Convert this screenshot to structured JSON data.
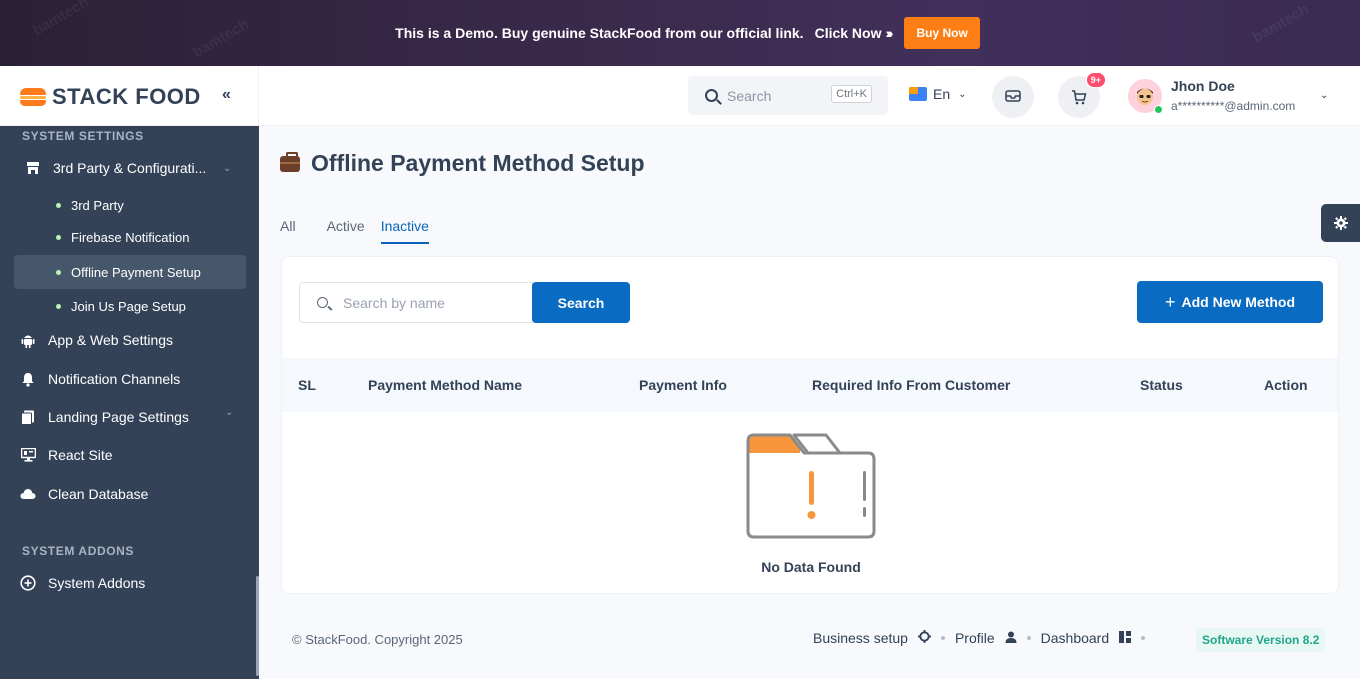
{
  "banner": {
    "text": "This is a Demo. Buy genuine StackFood from our official link.",
    "link": "Click Now",
    "arrows": "›››",
    "button": "Buy Now",
    "watermark": "bamtech"
  },
  "brand": {
    "name": "STACK FOOD",
    "collapse_icon": "«"
  },
  "sidebar": {
    "section1": "SYSTEM SETTINGS",
    "group": "3rd Party & Configurati...",
    "sub_items": [
      {
        "label": "3rd Party"
      },
      {
        "label": "Firebase Notification"
      },
      {
        "label": "Offline Payment Setup"
      },
      {
        "label": "Join Us Page Setup"
      }
    ],
    "items": [
      {
        "label": "App & Web Settings"
      },
      {
        "label": "Notification Channels"
      },
      {
        "label": "Landing Page Settings"
      },
      {
        "label": "React Site"
      },
      {
        "label": "Clean Database"
      }
    ],
    "section2": "SYSTEM ADDONS",
    "addons": "System Addons"
  },
  "header": {
    "search_placeholder": "Search",
    "shortcut": "Ctrl+K",
    "language": "En",
    "cart_badge": "9+",
    "user_name": "Jhon Doe",
    "user_email": "a**********@admin.com"
  },
  "main": {
    "title": "Offline Payment Method Setup",
    "tabs": [
      {
        "label": "All"
      },
      {
        "label": "Active"
      },
      {
        "label": "Inactive"
      }
    ],
    "search_placeholder": "Search by name",
    "search_button": "Search",
    "add_button": "Add New Method",
    "columns": [
      "SL",
      "Payment Method Name",
      "Payment Info",
      "Required Info From Customer",
      "Status",
      "Action"
    ],
    "empty_text": "No Data Found"
  },
  "footer": {
    "copyright": "© StackFood. Copyright 2025",
    "links": [
      "Business setup",
      "Profile",
      "Dashboard"
    ],
    "version": "Software Version 8.2"
  },
  "colors": {
    "sidebar": "#334257",
    "primary": "#0a6bc2",
    "buy": "#fd7e14"
  }
}
